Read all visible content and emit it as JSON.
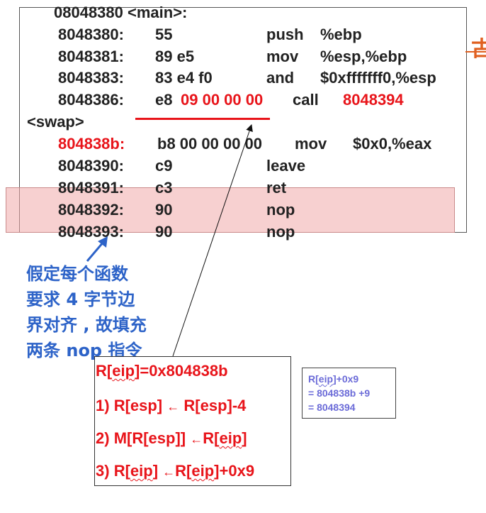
{
  "colors": {
    "address_highlight": "#e8141a",
    "note_text": "#2d63c8",
    "pad_highlight": "#f0aaaa",
    "calc_text": "#6b6bd8",
    "edge_glyph": "#e06020"
  },
  "main_header": "08048380 <main>:",
  "main_lines": [
    {
      "addr": "8048380:",
      "bytes": "55",
      "mnemonic": "push",
      "operands": "%ebp"
    },
    {
      "addr": "8048381:",
      "bytes": "89 e5",
      "mnemonic": "mov",
      "operands": "%esp,%ebp"
    },
    {
      "addr": "8048383:",
      "bytes": "83 e4 f0",
      "mnemonic": "and",
      "operands": "$0xfffffff0,%esp"
    }
  ],
  "call_line": {
    "addr": "8048386:",
    "bytes_prefix": "e8",
    "bytes_offset": "09 00 00 00",
    "mnemonic": "call",
    "target": "8048394"
  },
  "swap_header": "<swap>",
  "swap_lines": [
    {
      "addr": "804838b:",
      "bytes": "b8 00 00 00 00",
      "mnemonic": "mov",
      "operands": "$0x0,%eax"
    },
    {
      "addr": "8048390:",
      "bytes": "c9",
      "mnemonic": "leave",
      "operands": ""
    },
    {
      "addr": "8048391:",
      "bytes": "c3",
      "mnemonic": "ret",
      "operands": ""
    },
    {
      "addr": "8048392:",
      "bytes": "90",
      "mnemonic": "nop",
      "operands": ""
    },
    {
      "addr": "8048393:",
      "bytes": "90",
      "mnemonic": "nop",
      "operands": ""
    }
  ],
  "note_lines": [
    "假定每个函数",
    "要求 4 字节边",
    "界对齐 , 故填充",
    "两条 nop 指令"
  ],
  "eip_box": {
    "line0": {
      "a": "R[",
      "b": "eip",
      "c": "]=0x804838b"
    },
    "line1": {
      "num": "1)",
      "a": "R[esp]",
      "arrow": "←",
      "b": "R[esp]-4"
    },
    "line2": {
      "num": "2)",
      "a": "M[R[esp]]",
      "arrow": "←",
      "b1": "R[",
      "b2": "eip",
      "b3": "]"
    },
    "line3": {
      "num": "3)",
      "a1": "R[",
      "a2": "eip",
      "a3": "]",
      "arrow": "←",
      "b1": "R[",
      "b2": "eip",
      "b3": "]+0x9"
    }
  },
  "calc_box": {
    "line0": {
      "a": "R[",
      "b": "eip",
      "c": "]+0x9"
    },
    "line1": "= 804838b +9",
    "line2": "= 8048394"
  },
  "edge_glyph": "古"
}
